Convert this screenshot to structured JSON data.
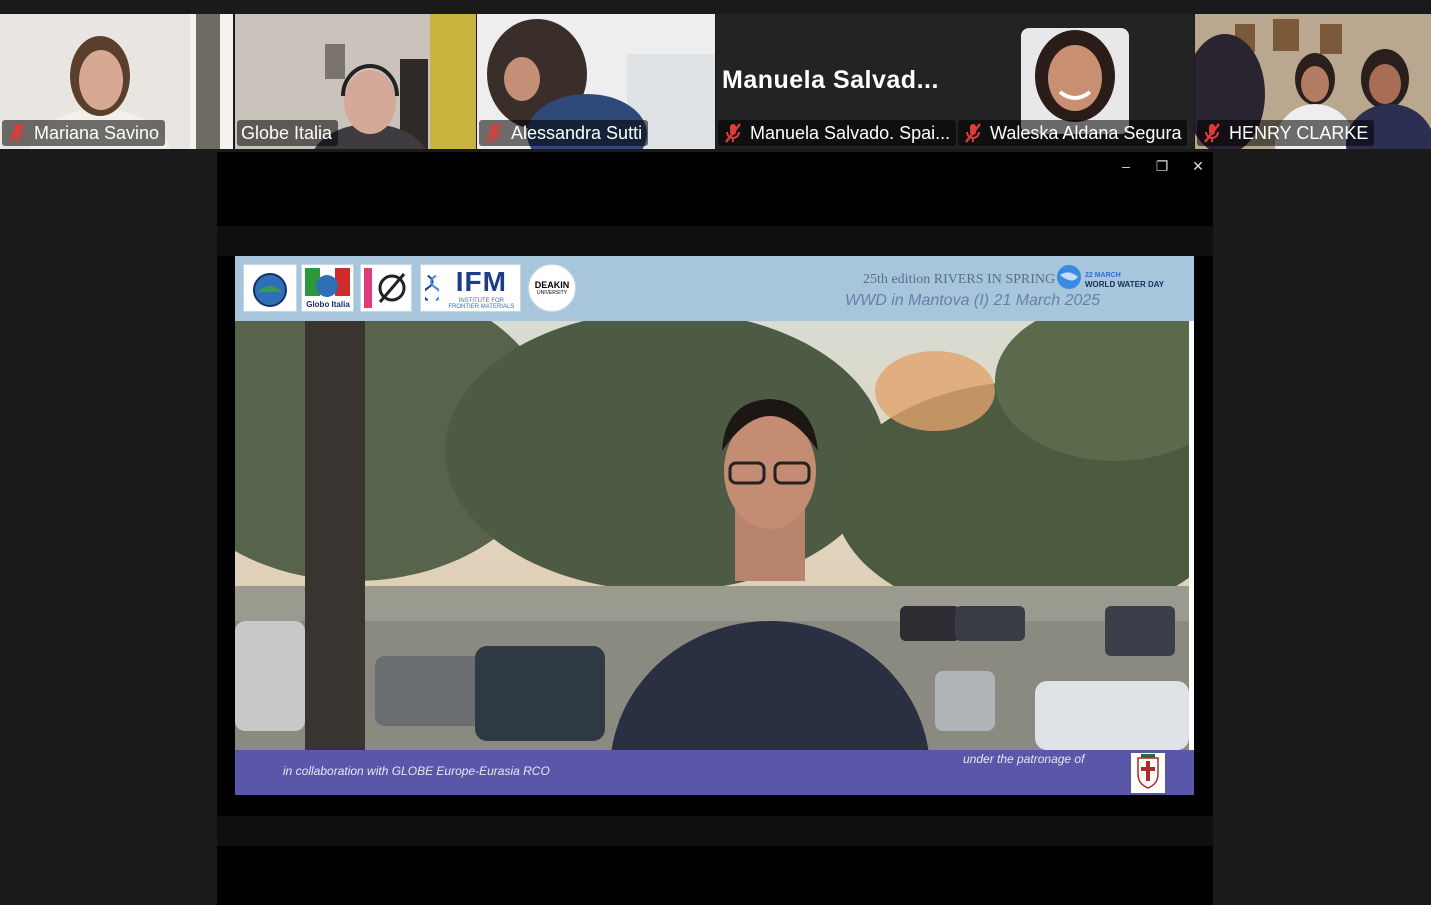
{
  "participants": [
    {
      "name": "Mariana Savino",
      "muted": true
    },
    {
      "name": "Globe Italia",
      "muted": false,
      "active": true
    },
    {
      "name": "Alessandra Sutti",
      "muted": true
    },
    {
      "name": "Manuela Salvado. Spai...",
      "display_name": "Manuela  Salvad...",
      "muted": true
    },
    {
      "name": "Waleska Aldana Segura",
      "muted": true
    },
    {
      "name": "HENRY CLARKE",
      "muted": true
    }
  ],
  "window_controls": {
    "minimize": "–",
    "restore": "❐",
    "close": "✕"
  },
  "slide": {
    "logos": [
      "The GLOBE Program",
      "Globo Italia",
      "LASTER-CREA",
      "IFM",
      "DEAKIN UNIVERSITY"
    ],
    "ifm": "IFM",
    "ifm_sub": "INSTITUTE FOR FRONTIER MATERIALS",
    "deakin": "DEAKIN",
    "deakin_sub": "UNIVERSITY",
    "edition": "25th edition RIVERS IN SPRING",
    "event": "WWD  in Mantova (I) 21 March 2025",
    "wwd_date": "22 MARCH",
    "wwd_title": "WORLD WATER DAY",
    "collaboration": "in collaboration with GLOBE Europe-Eurasia RCO",
    "patronage": "under the patronage of"
  },
  "colors": {
    "active_border": "#23d96c",
    "slide_header": "#a7c6db",
    "slide_footer": "#5b57a8",
    "mic_off": "#e03a3a"
  }
}
